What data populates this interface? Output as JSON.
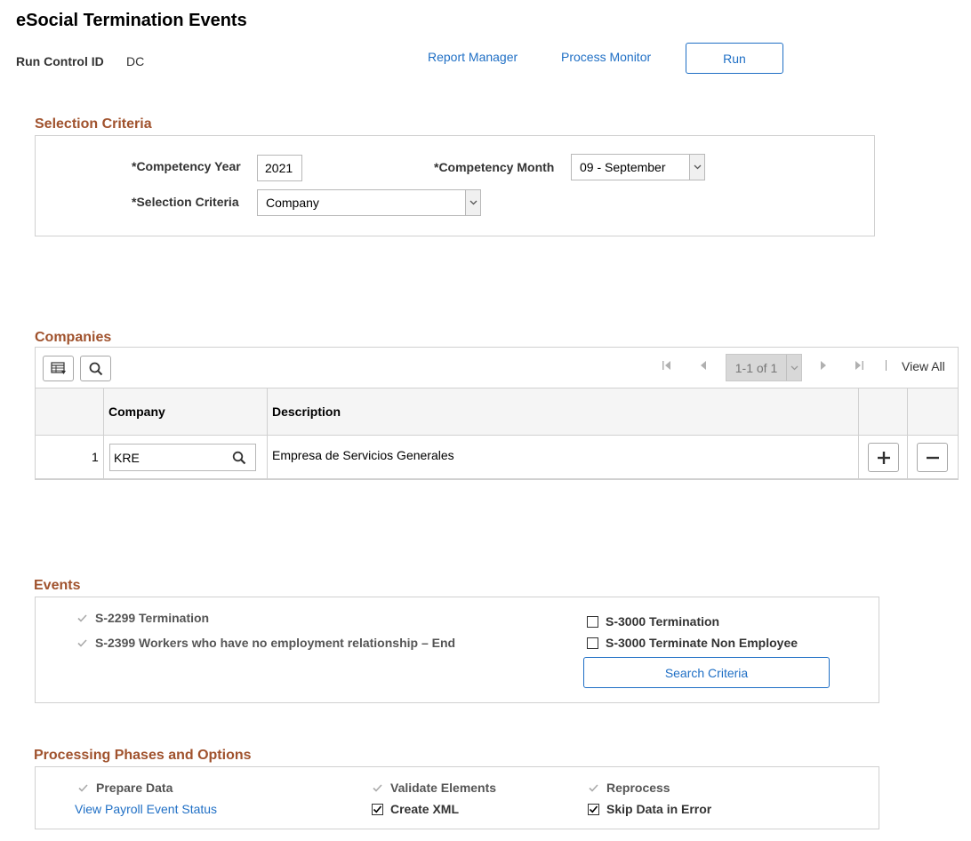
{
  "page": {
    "title": "eSocial Termination Events"
  },
  "run_control": {
    "label": "Run Control ID",
    "value": "DC"
  },
  "toolbar": {
    "report_manager": "Report Manager",
    "process_monitor": "Process Monitor",
    "run": "Run"
  },
  "selection": {
    "title": "Selection Criteria",
    "year_label": "*Competency Year",
    "year_value": "2021",
    "month_label": "*Competency Month",
    "month_value": "09 - September",
    "criteria_label": "*Selection Criteria",
    "criteria_value": "Company"
  },
  "companies": {
    "title": "Companies",
    "pager": "1-1 of 1",
    "view_all": "View All",
    "columns": [
      "Company",
      "Description"
    ],
    "rows": [
      {
        "num": "1",
        "company": "KRE",
        "description": "Empresa de Servicios Generales"
      }
    ]
  },
  "events": {
    "title": "Events",
    "items": [
      {
        "label": "S-2299 Termination",
        "checked": true,
        "disabled": true
      },
      {
        "label": "S-2399 Workers who have no employment relationship – End",
        "checked": true,
        "disabled": true
      },
      {
        "label": "S-3000 Termination",
        "checked": false,
        "disabled": false
      },
      {
        "label": "S-3000 Terminate Non Employee",
        "checked": false,
        "disabled": false
      }
    ],
    "search_criteria": "Search Criteria"
  },
  "processing": {
    "title": "Processing Phases and Options",
    "prepare_data": "Prepare Data",
    "view_payroll_link": "View Payroll Event Status",
    "validate_elements": "Validate Elements",
    "create_xml": "Create XML",
    "reprocess": "Reprocess",
    "skip_data_in_error": "Skip Data in Error"
  },
  "colors": {
    "link": "#1f6fc5",
    "section_title": "#a0522d",
    "border": "#d0d0d0"
  }
}
